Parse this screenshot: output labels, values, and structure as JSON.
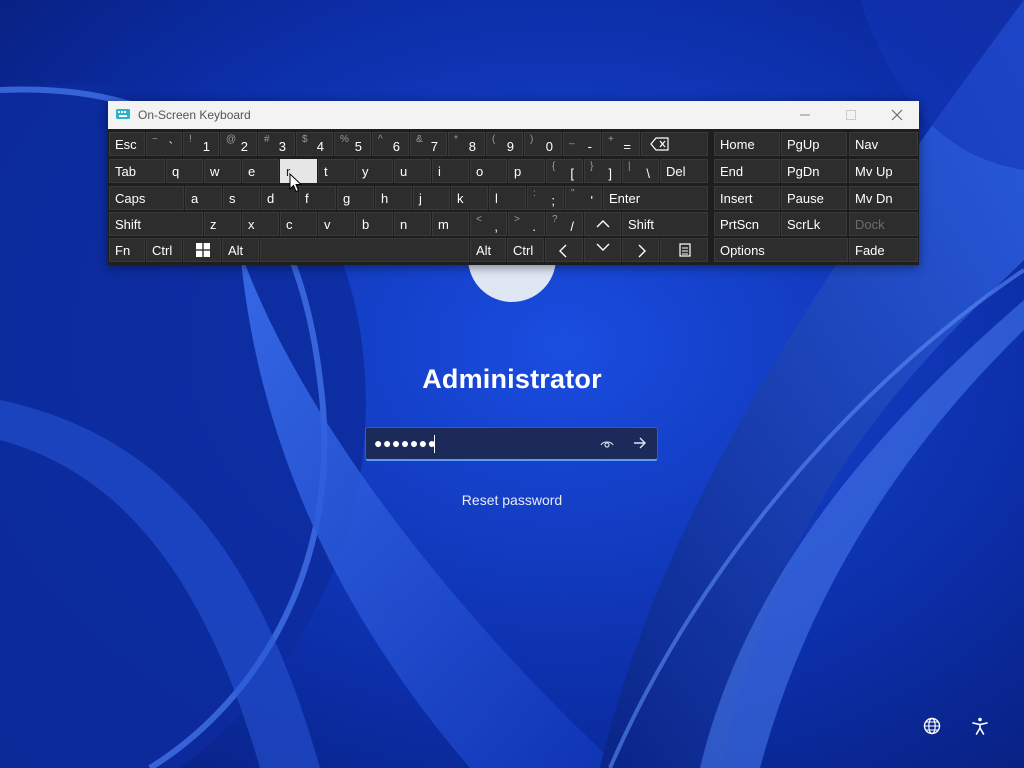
{
  "osk": {
    "title": "On-Screen Keyboard",
    "rows": [
      [
        {
          "label": "Esc"
        },
        {
          "shift": "~",
          "main": "`"
        },
        {
          "shift": "!",
          "main": "1"
        },
        {
          "shift": "@",
          "main": "2"
        },
        {
          "shift": "#",
          "main": "3"
        },
        {
          "shift": "$",
          "main": "4"
        },
        {
          "shift": "%",
          "main": "5"
        },
        {
          "shift": "^",
          "main": "6"
        },
        {
          "shift": "&",
          "main": "7"
        },
        {
          "shift": "*",
          "main": "8"
        },
        {
          "shift": "(",
          "main": "9"
        },
        {
          "shift": ")",
          "main": "0"
        },
        {
          "shift": "_",
          "main": "-"
        },
        {
          "shift": "+",
          "main": "="
        },
        {
          "icon": "backspace-icon"
        },
        {
          "label": "Home"
        },
        {
          "label": "PgUp"
        },
        {
          "label": "Nav"
        }
      ],
      [
        {
          "label": "Tab"
        },
        {
          "label": "q"
        },
        {
          "label": "w"
        },
        {
          "label": "e"
        },
        {
          "label": "r",
          "pressed": true
        },
        {
          "label": "t"
        },
        {
          "label": "y"
        },
        {
          "label": "u"
        },
        {
          "label": "i"
        },
        {
          "label": "o"
        },
        {
          "label": "p"
        },
        {
          "shift": "{",
          "main": "["
        },
        {
          "shift": "}",
          "main": "]"
        },
        {
          "shift": "|",
          "main": "\\"
        },
        {
          "label": "Del"
        },
        {
          "label": "End"
        },
        {
          "label": "PgDn"
        },
        {
          "label": "Mv Up"
        }
      ],
      [
        {
          "label": "Caps"
        },
        {
          "label": "a"
        },
        {
          "label": "s"
        },
        {
          "label": "d"
        },
        {
          "label": "f"
        },
        {
          "label": "g"
        },
        {
          "label": "h"
        },
        {
          "label": "j"
        },
        {
          "label": "k"
        },
        {
          "label": "l"
        },
        {
          "shift": ":",
          "main": ";"
        },
        {
          "shift": "\"",
          "main": "'"
        },
        {
          "label": "Enter"
        },
        {
          "label": "Insert"
        },
        {
          "label": "Pause"
        },
        {
          "label": "Mv Dn"
        }
      ],
      [
        {
          "label": "Shift"
        },
        {
          "label": "z"
        },
        {
          "label": "x"
        },
        {
          "label": "c"
        },
        {
          "label": "v"
        },
        {
          "label": "b"
        },
        {
          "label": "n"
        },
        {
          "label": "m"
        },
        {
          "shift": "<",
          "main": ","
        },
        {
          "shift": ">",
          "main": "."
        },
        {
          "shift": "?",
          "main": "/"
        },
        {
          "icon": "arrow-up-icon"
        },
        {
          "label": "Shift"
        },
        {
          "label": "PrtScn"
        },
        {
          "label": "ScrLk"
        },
        {
          "label": "Dock",
          "disabled": true
        }
      ],
      [
        {
          "label": "Fn"
        },
        {
          "label": "Ctrl"
        },
        {
          "icon": "windows-icon"
        },
        {
          "label": "Alt"
        },
        {
          "label": ""
        },
        {
          "label": "Alt"
        },
        {
          "label": "Ctrl"
        },
        {
          "icon": "arrow-left-icon"
        },
        {
          "icon": "arrow-down-icon"
        },
        {
          "icon": "arrow-right-icon"
        },
        {
          "icon": "menu-icon"
        },
        {
          "label": "Options"
        },
        {
          "label": "Fade"
        }
      ]
    ]
  },
  "login": {
    "user_name": "Administrator",
    "password_mask": "●●●●●●●",
    "reset_link": "Reset password"
  },
  "colors": {
    "wallpaper_dark": "#061a6e",
    "wallpaper_light": "#2f63e6",
    "accent": "#5b9bf6"
  }
}
